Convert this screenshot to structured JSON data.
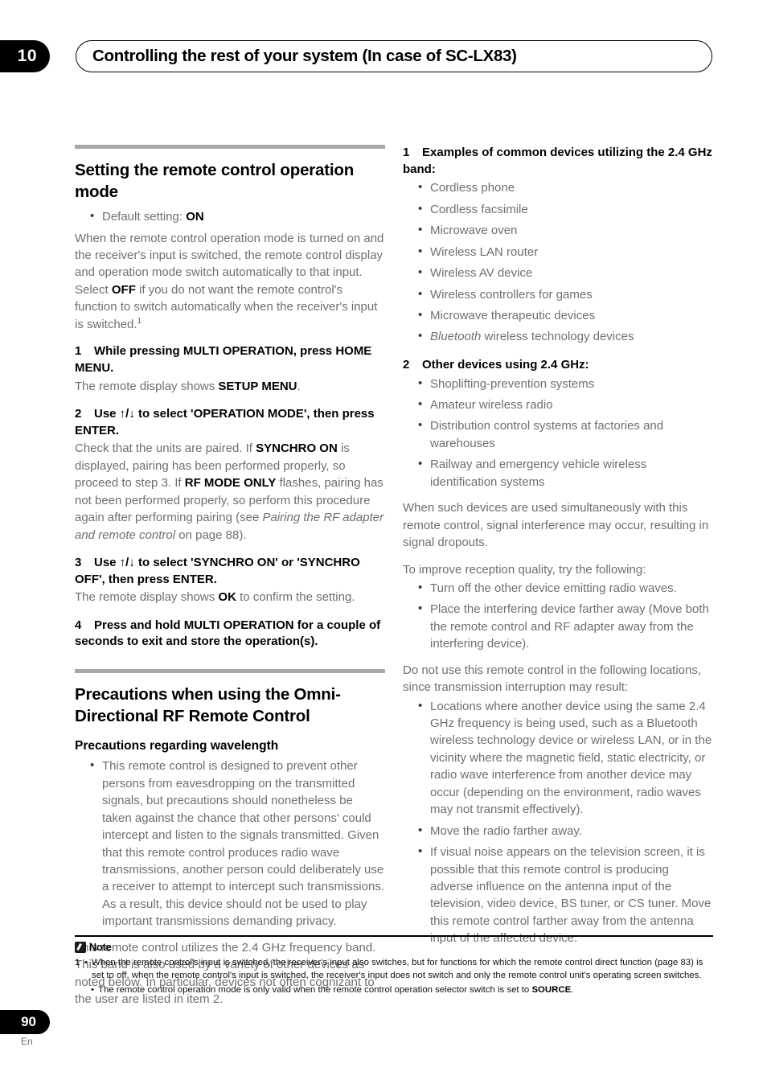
{
  "header": {
    "chapter_number": "10",
    "title": "Controlling the rest of your system (In case of SC-LX83)"
  },
  "left_column": {
    "section1": {
      "heading": "Setting the remote control operation mode",
      "default_setting_bullet": "Default setting: ON",
      "default_setting_label": "Default setting: ",
      "default_setting_value": "ON",
      "intro_paragraph": "When the remote control operation mode is turned on and the receiver's input is switched, the remote control display and operation mode switch automatically to that input. Select OFF if you do not want the remote control's function to switch automatically when the receiver's input is switched.",
      "intro_part1": "When the remote control operation mode is turned on and the receiver's input is switched, the remote control display and operation mode switch automatically to that input. Select ",
      "intro_bold": "OFF",
      "intro_part2": " if you do not want the remote control's function to switch automatically when the receiver's input is switched.",
      "intro_footnote_marker": "1",
      "steps": [
        {
          "number": "1",
          "title": "While pressing MULTI OPERATION, press HOME MENU.",
          "body_part1": "The remote display shows ",
          "body_bold": "SETUP MENU",
          "body_part2": "."
        },
        {
          "number": "2",
          "title": "Use ↑/↓ to select 'OPERATION MODE', then press ENTER.",
          "body_part1": "Check that the units are paired. If ",
          "body_bold1": "SYNCHRO ON",
          "body_part2": " is displayed, pairing has been performed properly, so proceed to step 3. If ",
          "body_bold2": "RF MODE ONLY",
          "body_part3": " flashes, pairing has not been performed properly, so perform this procedure again after performing pairing (see ",
          "body_italic": "Pairing the RF adapter and remote control",
          "body_part4": " on page 88)."
        },
        {
          "number": "3",
          "title": "Use ↑/↓ to select 'SYNCHRO ON' or 'SYNCHRO OFF', then press ENTER.",
          "body_part1": "The remote display shows ",
          "body_bold": "OK",
          "body_part2": " to confirm the setting."
        },
        {
          "number": "4",
          "title": "Press and hold MULTI OPERATION for a couple of seconds to exit and store the operation(s)."
        }
      ]
    },
    "section2": {
      "heading": "Precautions when using the Omni-Directional RF Remote Control",
      "subheading": "Precautions regarding wavelength",
      "bullet1": "This remote control is designed to prevent other persons from eavesdropping on the transmitted signals, but precautions should nonetheless be taken against the chance that other persons' could intercept and listen to the signals transmitted. Given that this remote control produces radio wave transmissions, another person could deliberately use a receiver to attempt to intercept such transmissions. As a result, this device should not be used to play important transmissions demanding privacy.",
      "closing_paragraph": "This remote control utilizes the 2.4 GHz frequency band. This band is also used by a variety of other devices as noted below. In particular, devices not often cognizant to the user are listed in item 2."
    }
  },
  "right_column": {
    "list1": {
      "number": "1",
      "title": "Examples of common devices utilizing the 2.4 GHz band:",
      "items": [
        "Cordless phone",
        "Cordless facsimile",
        "Microwave oven",
        "Wireless LAN router",
        "Wireless AV device",
        "Wireless controllers for games",
        "Microwave therapeutic devices"
      ],
      "italic_item_prefix": "Bluetooth",
      "italic_item_rest": " wireless technology devices"
    },
    "list2": {
      "number": "2",
      "title": "Other devices using 2.4 GHz:",
      "items": [
        "Shoplifting-prevention systems",
        "Amateur wireless radio",
        "Distribution control systems at factories and warehouses",
        "Railway and emergency vehicle wireless identification systems"
      ]
    },
    "paragraph1": "When such devices are used simultaneously with this remote control, signal interference may occur, resulting in signal dropouts.",
    "paragraph2": "To improve reception quality, try the following:",
    "improve_items": [
      "Turn off the other device emitting radio waves.",
      "Place the interfering device farther away (Move both the remote control and RF adapter away from the interfering device)."
    ],
    "paragraph3": "Do not use this remote control in the following locations, since transmission interruption may result:",
    "location_items": [
      "Locations where another device using the same 2.4 GHz frequency is being used, such as a Bluetooth wireless technology device or wireless LAN, or in the vicinity where the magnetic field, static electricity, or radio wave interference from another device may occur (depending on the environment, radio waves may not transmit effectively).",
      "Move the radio farther away.",
      "If visual noise appears on the television screen, it is possible that this remote control is producing adverse influence on the antenna input of the television, video device, BS tuner, or CS tuner. Move this remote control farther away from the antenna input of the affected device."
    ]
  },
  "footnote": {
    "label": "Note",
    "icon": "pencil-note-icon",
    "item1_marker": "1",
    "item1_text": "When the remote control's input is switched, the receiver's input also switches, but for functions for which the remote control direct function (page 83) is set to off, when the remote control's input is switched, the receiver's input does not switch and only the remote control unit's operating screen switches.",
    "item2_part1": "The remote control operation mode is only valid when the remote control operation selector switch is set to ",
    "item2_bold": "SOURCE",
    "item2_part2": "."
  },
  "page_footer": {
    "page_number": "90",
    "language": "En"
  }
}
